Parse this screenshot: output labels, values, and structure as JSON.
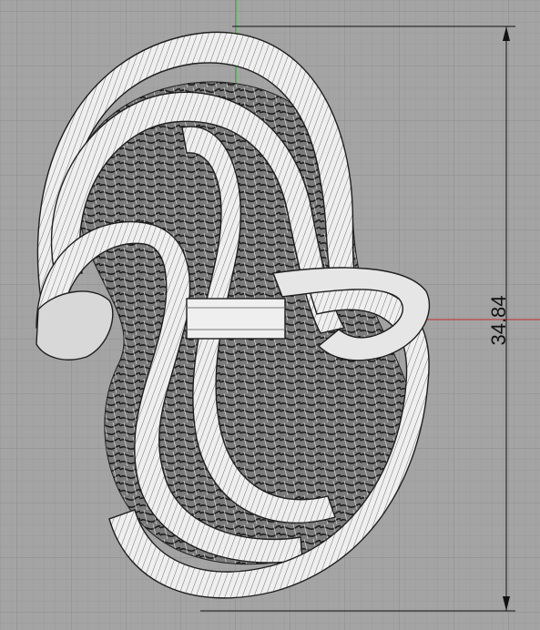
{
  "viewport": {
    "background_color": "#a4a4a4",
    "grid_minor_color": "#9a9a9a",
    "grid_major_color": "#8e8e8e",
    "x_axis_color": "#c04040",
    "y_axis_color": "#3fae3f"
  },
  "model": {
    "description_icon": "wireframe-mesh-model",
    "band_fill": "#efefef",
    "band_shade": "#d2d2d2",
    "edge_color": "#222222",
    "lattice_color": "#2a2a2a"
  },
  "dimension": {
    "value": "34.84",
    "line_color": "#111111"
  }
}
